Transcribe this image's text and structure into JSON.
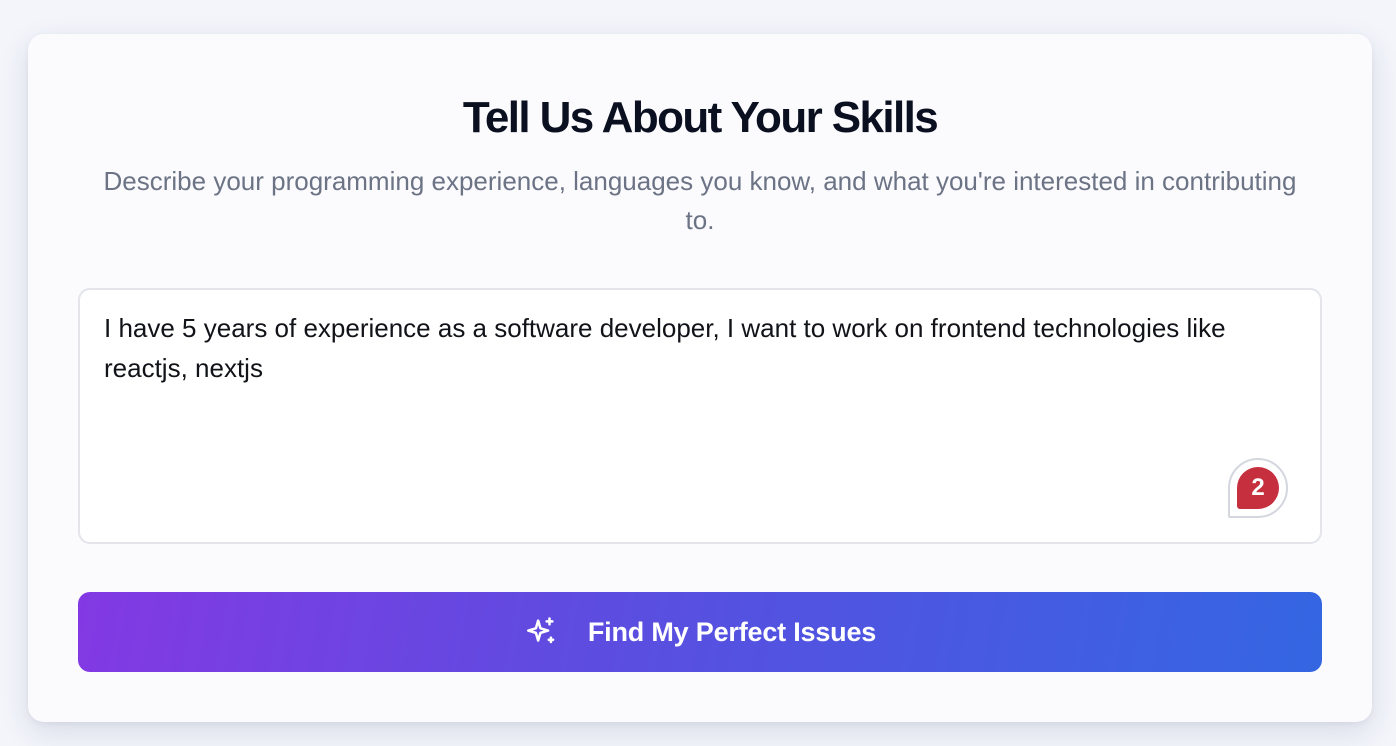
{
  "header": {
    "title": "Tell Us About Your Skills",
    "subtitle": "Describe your programming experience, languages you know, and what you're interested in contributing to."
  },
  "skills_input": {
    "value": "I have 5 years of experience as a software developer, I want to work on frontend technologies like reactjs, nextjs"
  },
  "notification_badge": {
    "count": "2",
    "color": "#c62f3e"
  },
  "submit_button": {
    "label": "Find My Perfect Issues",
    "icon": "sparkles-icon",
    "gradient_start": "#8339e3",
    "gradient_end": "#3466e2"
  }
}
